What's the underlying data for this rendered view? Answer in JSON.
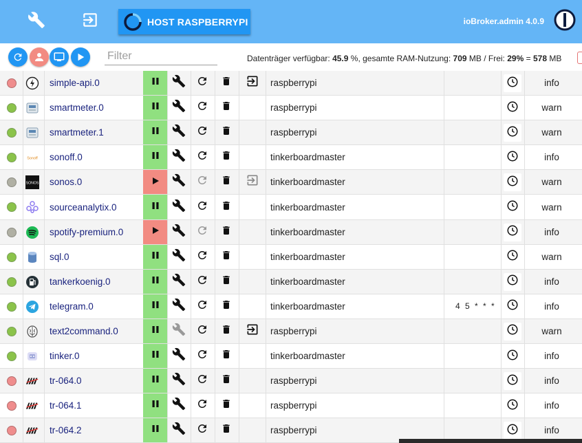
{
  "topbar": {
    "host_label": "HOST RASPBERRYPI",
    "brand": "ioBroker.admin 4.0.9",
    "icons": [
      "wrench-icon",
      "enter-icon",
      "host-ring-icon",
      "iobroker-logo-icon"
    ]
  },
  "toolbar": {
    "buttons": [
      "refresh-icon",
      "expert-mode-icon",
      "install-url-icon",
      "play-icon"
    ],
    "filter_placeholder": "Filter",
    "disk_label": "Datenträger verfügbar:",
    "disk_value": "45.9",
    "ram_label": "%, gesamte RAM-Nutzung:",
    "ram_value": "709",
    "free_label": "MB / Frei:",
    "free_pct": "29%",
    "equals": "=",
    "free_mb": "578",
    "mb": "MB"
  },
  "colors": {
    "topbar": "#64b5f6",
    "primary": "#2196f3",
    "running": "#90e080",
    "stopped": "#f28b82",
    "name": "#1a237e"
  },
  "adapters": [
    {
      "dot": "red",
      "icon": "lightning-icon",
      "name": "simple-api.0",
      "running": true,
      "wrench": true,
      "restart": true,
      "enter": true,
      "host": "raspberrypi",
      "extra": "",
      "level": "info"
    },
    {
      "dot": "green",
      "icon": "smartmeter-icon",
      "name": "smartmeter.0",
      "running": true,
      "wrench": true,
      "restart": true,
      "enter": false,
      "host": "raspberrypi",
      "extra": "",
      "level": "warn"
    },
    {
      "dot": "green",
      "icon": "smartmeter-icon",
      "name": "smartmeter.1",
      "running": true,
      "wrench": true,
      "restart": true,
      "enter": false,
      "host": "raspberrypi",
      "extra": "",
      "level": "warn"
    },
    {
      "dot": "green",
      "icon": "sonoff-icon",
      "name": "sonoff.0",
      "running": true,
      "wrench": true,
      "restart": true,
      "enter": false,
      "host": "tinkerboardmaster",
      "extra": "",
      "level": "info"
    },
    {
      "dot": "grey",
      "icon": "sonos-icon",
      "name": "sonos.0",
      "running": false,
      "wrench": true,
      "restart": false,
      "enter": true,
      "host": "tinkerboardmaster",
      "extra": "",
      "level": "warn"
    },
    {
      "dot": "green",
      "icon": "sourceanalytix-icon",
      "name": "sourceanalytix.0",
      "running": true,
      "wrench": true,
      "restart": true,
      "enter": false,
      "host": "tinkerboardmaster",
      "extra": "",
      "level": "warn"
    },
    {
      "dot": "grey",
      "icon": "spotify-icon",
      "name": "spotify-premium.0",
      "running": false,
      "wrench": true,
      "restart": false,
      "enter": false,
      "host": "tinkerboardmaster",
      "extra": "",
      "level": "info"
    },
    {
      "dot": "green",
      "icon": "database-icon",
      "name": "sql.0",
      "running": true,
      "wrench": true,
      "restart": true,
      "enter": false,
      "host": "tinkerboardmaster",
      "extra": "",
      "level": "warn"
    },
    {
      "dot": "green",
      "icon": "fuel-pump-icon",
      "name": "tankerkoenig.0",
      "running": true,
      "wrench": true,
      "restart": true,
      "enter": false,
      "host": "tinkerboardmaster",
      "extra": "",
      "level": "info"
    },
    {
      "dot": "green",
      "icon": "telegram-icon",
      "name": "telegram.0",
      "running": true,
      "wrench": true,
      "restart": true,
      "enter": false,
      "host": "tinkerboardmaster",
      "extra": "4 5 * * *",
      "level": "info"
    },
    {
      "dot": "green",
      "icon": "brain-icon",
      "name": "text2command.0",
      "running": true,
      "wrench": false,
      "restart": true,
      "enter": true,
      "host": "raspberrypi",
      "extra": "",
      "level": "warn"
    },
    {
      "dot": "green",
      "icon": "tinker-icon",
      "name": "tinker.0",
      "running": true,
      "wrench": true,
      "restart": true,
      "enter": false,
      "host": "tinkerboardmaster",
      "extra": "",
      "level": "info"
    },
    {
      "dot": "red",
      "icon": "avm-icon",
      "name": "tr-064.0",
      "running": true,
      "wrench": true,
      "restart": true,
      "enter": false,
      "host": "raspberrypi",
      "extra": "",
      "level": "info"
    },
    {
      "dot": "red",
      "icon": "avm-icon",
      "name": "tr-064.1",
      "running": true,
      "wrench": true,
      "restart": true,
      "enter": false,
      "host": "raspberrypi",
      "extra": "",
      "level": "info"
    },
    {
      "dot": "red",
      "icon": "avm-icon",
      "name": "tr-064.2",
      "running": true,
      "wrench": true,
      "restart": true,
      "enter": false,
      "host": "raspberrypi",
      "extra": "",
      "level": "info"
    }
  ]
}
